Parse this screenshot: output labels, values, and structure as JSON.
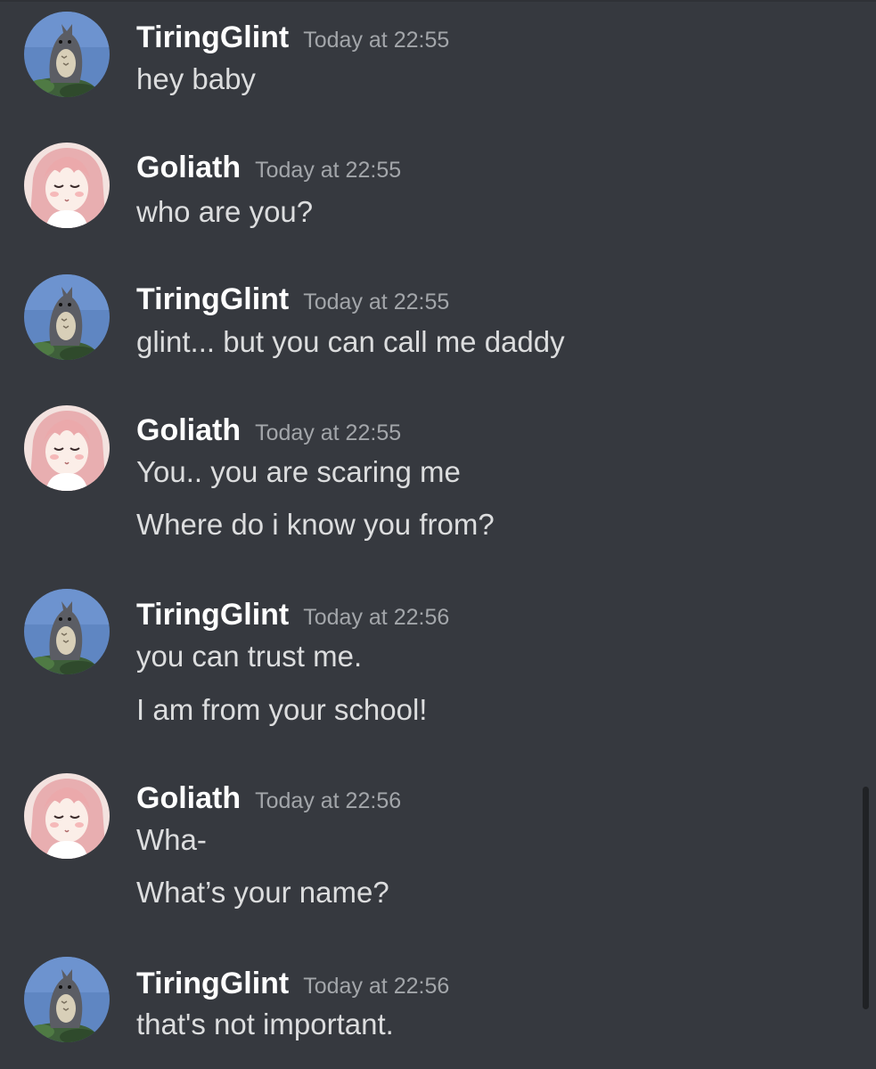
{
  "messages": [
    {
      "author": "TiringGlint",
      "avatar_icon": "totoro-avatar-icon",
      "timestamp": "Today at 22:55",
      "lines": [
        "hey baby"
      ]
    },
    {
      "author": "Goliath",
      "avatar_icon": "anime-girl-avatar-icon",
      "timestamp": "Today at 22:55",
      "lines": [
        "who are you?"
      ]
    },
    {
      "author": "TiringGlint",
      "avatar_icon": "totoro-avatar-icon",
      "timestamp": "Today at 22:55",
      "lines": [
        "glint... but you can call me daddy"
      ]
    },
    {
      "author": "Goliath",
      "avatar_icon": "anime-girl-avatar-icon",
      "timestamp": "Today at 22:55",
      "lines": [
        "You.. you are scaring me",
        "Where do i know you from?"
      ]
    },
    {
      "author": "TiringGlint",
      "avatar_icon": "totoro-avatar-icon",
      "timestamp": "Today at 22:56",
      "lines": [
        "you can trust me.",
        "I am from your school!"
      ]
    },
    {
      "author": "Goliath",
      "avatar_icon": "anime-girl-avatar-icon",
      "timestamp": "Today at 22:56",
      "lines": [
        "Wha-",
        "What’s your name?"
      ]
    },
    {
      "author": "TiringGlint",
      "avatar_icon": "totoro-avatar-icon",
      "timestamp": "Today at 22:56",
      "lines": [
        "that's not important."
      ]
    }
  ],
  "colors": {
    "background": "#36393f",
    "username": "#ffffff",
    "timestamp": "#a3a6aa",
    "message_text": "#dcddde",
    "scrollbar": "#202225"
  }
}
